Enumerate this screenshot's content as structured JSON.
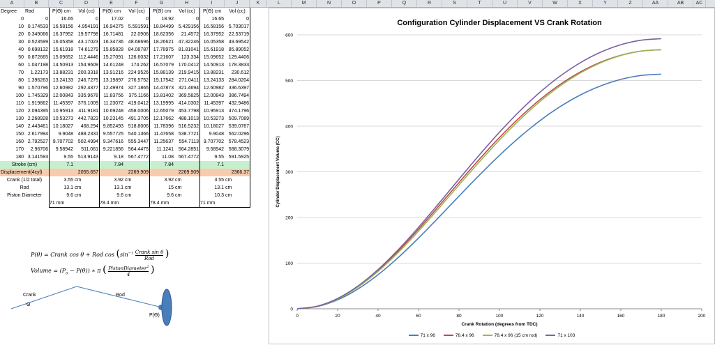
{
  "column_headers": [
    "A",
    "B",
    "C",
    "D",
    "E",
    "F",
    "G",
    "H",
    "I",
    "J",
    "K",
    "L",
    "M",
    "N",
    "O",
    "P",
    "Q",
    "R",
    "S",
    "T",
    "U",
    "V",
    "W",
    "X",
    "Y",
    "Z",
    "AA",
    "AB",
    "AC"
  ],
  "sheet": {
    "header": [
      "Degree",
      "Rad",
      "P(Θ) cm",
      "Vol (cc)",
      "P(Θ) cm",
      "Vol (cc)",
      "P(Θ) cm",
      "Vol (cc)",
      "P(Θ) cm",
      "Vol (cc)"
    ],
    "rows": [
      [
        "0",
        "0",
        "16.65",
        "0",
        "17.02",
        "0",
        "18.92",
        "0",
        "16.65",
        "0"
      ],
      [
        "10",
        "0.174533",
        "16.58156",
        "4.954191",
        "16.94275",
        "5.591591",
        "18.84499",
        "5.429156",
        "16.58156",
        "5.703017"
      ],
      [
        "20",
        "0.349066",
        "16.37952",
        "19.57798",
        "16.71481",
        "22.0906",
        "18.62356",
        "21.4572",
        "16.37952",
        "22.53719"
      ],
      [
        "30",
        "0.523599",
        "16.05358",
        "43.17023",
        "16.34736",
        "48.68696",
        "18.26621",
        "47.32246",
        "16.05358",
        "49.69542"
      ],
      [
        "40",
        "0.698132",
        "15.61918",
        "74.61279",
        "15.85828",
        "84.08787",
        "17.78975",
        "81.81041",
        "15.61918",
        "85.89052"
      ],
      [
        "50",
        "0.872665",
        "15.09652",
        "112.4446",
        "15.27091",
        "126.6032",
        "17.21607",
        "123.334",
        "15.09652",
        "129.4406"
      ],
      [
        "60",
        "1.047198",
        "14.50913",
        "154.9609",
        "14.61248",
        "174.262",
        "16.57079",
        "170.0412",
        "14.50913",
        "178.3833"
      ],
      [
        "70",
        "1.22173",
        "13.88231",
        "200.3318",
        "13.91216",
        "224.9526",
        "15.88139",
        "219.9415",
        "13.88231",
        "230.612"
      ],
      [
        "80",
        "1.396263",
        "13.24133",
        "246.7275",
        "13.19897",
        "276.5752",
        "15.17542",
        "271.0411",
        "13.24133",
        "284.0204"
      ],
      [
        "90",
        "1.570796",
        "12.60982",
        "292.4377",
        "12.49974",
        "327.1865",
        "14.47873",
        "321.4694",
        "12.60982",
        "336.6397"
      ],
      [
        "100",
        "1.745329",
        "12.00843",
        "335.9678",
        "11.83756",
        "375.1166",
        "13.81402",
        "369.5825",
        "12.00843",
        "386.7494"
      ],
      [
        "110",
        "1.919862",
        "11.45397",
        "376.1009",
        "11.23072",
        "419.0412",
        "13.19995",
        "414.0302",
        "11.45397",
        "432.9486"
      ],
      [
        "120",
        "2.094395",
        "10.95913",
        "411.9181",
        "10.69248",
        "458.0006",
        "12.65079",
        "453.7798",
        "10.95913",
        "474.1796"
      ],
      [
        "130",
        "2.268928",
        "10.53273",
        "442.7823",
        "10.23145",
        "491.3705",
        "12.17662",
        "488.1013",
        "10.53273",
        "509.7089"
      ],
      [
        "140",
        "2.443461",
        "10.18027",
        "468.294",
        "9.852493",
        "518.8006",
        "11.78396",
        "516.5232",
        "10.18027",
        "539.0767"
      ],
      [
        "150",
        "2.617994",
        "9.9048",
        "488.2331",
        "9.557725",
        "540.1366",
        "11.47658",
        "538.7721",
        "9.9048",
        "562.0296"
      ],
      [
        "160",
        "2.792527",
        "9.707702",
        "502.4994",
        "9.347616",
        "555.3447",
        "11.25637",
        "554.7113",
        "9.707702",
        "578.4523"
      ],
      [
        "170",
        "2.96706",
        "9.58942",
        "511.061",
        "9.221856",
        "564.4475",
        "11.1241",
        "564.2851",
        "9.58942",
        "588.3079"
      ],
      [
        "180",
        "3.141593",
        "9.55",
        "513.9143",
        "9.18",
        "567.4772",
        "11.08",
        "567.4772",
        "9.55",
        "591.5925"
      ]
    ],
    "stroke": {
      "label": "Stroke (cm)",
      "values": [
        "7.1",
        "7.84",
        "7.84",
        "7.1"
      ]
    },
    "displacement": {
      "label": "Displacement(4cyl)",
      "values": [
        "2055.657",
        "2269.909",
        "2269.909",
        "2366.37"
      ]
    },
    "params": [
      {
        "label": "Crank (1/2 total)",
        "values": [
          "3.55",
          "3.92",
          "3.92",
          "3.55"
        ],
        "unit": "cm"
      },
      {
        "label": "Rod",
        "values": [
          "13.1",
          "13.1",
          "15",
          "13.1"
        ],
        "unit": "cm"
      },
      {
        "label": "Piston Diameter",
        "values": [
          "9.6",
          "9.6",
          "9.6",
          "10.3"
        ],
        "unit": "cm"
      }
    ],
    "config_labels": [
      "71 mm",
      "78.4 mm",
      "78.4 mm",
      "71 mm"
    ]
  },
  "diagram": {
    "crank_label": "Crank",
    "theta_label": "Θ",
    "rod_label": "Rod",
    "piston_label": "P(Θ)"
  },
  "chart_data": {
    "type": "line",
    "title": "Configuration Cylinder Displacement VS Crank Rotation",
    "xlabel": "Crank Rotation (degrees from TDC)",
    "ylabel": "Cylinder Displacement Volume (CC)",
    "xlim": [
      0,
      200
    ],
    "ylim": [
      0,
      600
    ],
    "xticks": [
      0,
      20,
      40,
      60,
      80,
      100,
      120,
      140,
      160,
      180,
      200
    ],
    "yticks": [
      0,
      100,
      200,
      300,
      400,
      500,
      600
    ],
    "grid": "horizontal",
    "legend_position": "bottom",
    "x": [
      0,
      10,
      20,
      30,
      40,
      50,
      60,
      70,
      80,
      90,
      100,
      110,
      120,
      130,
      140,
      150,
      160,
      170,
      180
    ],
    "series": [
      {
        "name": "71 x 96",
        "color": "#4a7ebb",
        "values": [
          0,
          4.954191,
          19.57798,
          43.17023,
          74.61279,
          112.4446,
          154.9609,
          200.3318,
          246.7275,
          292.4377,
          335.9678,
          376.1009,
          411.9181,
          442.7823,
          468.294,
          488.2331,
          502.4994,
          511.061,
          513.9143
        ]
      },
      {
        "name": "78.4 x 96",
        "color": "#be4b48",
        "values": [
          0,
          5.591591,
          22.0906,
          48.68696,
          84.08787,
          126.6032,
          174.262,
          224.9526,
          276.5752,
          327.1865,
          375.1166,
          419.0412,
          458.0006,
          491.3705,
          518.8006,
          540.1366,
          555.3447,
          564.4475,
          567.4772
        ]
      },
      {
        "name": "78.4 x 96 (15 cm rod)",
        "color": "#98b954",
        "values": [
          0,
          5.429156,
          21.4572,
          47.32246,
          81.81041,
          123.334,
          170.0412,
          219.9415,
          271.0411,
          321.4694,
          369.5825,
          414.0302,
          453.7798,
          488.1013,
          516.5232,
          538.7721,
          554.7113,
          564.2851,
          567.4772
        ]
      },
      {
        "name": "71 x 103",
        "color": "#7d60a0",
        "values": [
          0,
          5.703017,
          22.53719,
          49.69542,
          85.89052,
          129.4406,
          178.3833,
          230.612,
          284.0204,
          336.6397,
          386.7494,
          432.9486,
          474.1796,
          509.7089,
          539.0767,
          562.0296,
          578.4523,
          588.3079,
          591.5925
        ]
      }
    ]
  }
}
